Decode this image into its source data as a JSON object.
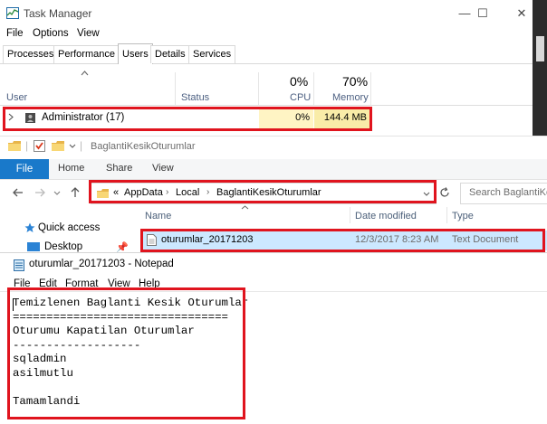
{
  "task_manager": {
    "title": "Task Manager",
    "menu": [
      "File",
      "Options",
      "View"
    ],
    "tabs": [
      "Processes",
      "Performance",
      "Users",
      "Details",
      "Services"
    ],
    "active_tab": "Users",
    "columns": {
      "user": "User",
      "status": "Status",
      "cpu_percent": "0%",
      "cpu": "CPU",
      "memory_percent": "70%",
      "memory": "Memory"
    },
    "row": {
      "name": "Administrator (17)",
      "cpu": "0%",
      "memory": "144.4 MB"
    }
  },
  "explorer": {
    "title": "BaglantiKesikOturumlar",
    "ribbon_tabs": [
      "File",
      "Home",
      "Share",
      "View"
    ],
    "breadcrumb": [
      "AppData",
      "Local",
      "BaglantiKesikOturumlar"
    ],
    "breadcrumb_prefix": "«",
    "search_placeholder": "Search BaglantiKes",
    "columns": {
      "name": "Name",
      "date_modified": "Date modified",
      "type": "Type"
    },
    "nav": {
      "quick_access": "Quick access",
      "desktop": "Desktop"
    },
    "file": {
      "name": "oturumlar_20171203",
      "date_modified": "12/3/2017 8:23 AM",
      "type": "Text Document"
    }
  },
  "notepad": {
    "title": "oturumlar_20171203 - Notepad",
    "menu": [
      "File",
      "Edit",
      "Format",
      "View",
      "Help"
    ],
    "content": "Temizlenen Baglanti Kesik Oturumlar\n================================\nOturumu Kapatilan Oturumlar\n-------------------\nsqladmin\nasilmutlu\n\nTamamlandi"
  },
  "colors": {
    "highlight_red": "#e0141e",
    "resource_yellow": "#fff4c4",
    "memory_yellow": "#f9eca8",
    "file_tab_blue": "#1979ca",
    "selection_blue": "#cce8ff"
  }
}
